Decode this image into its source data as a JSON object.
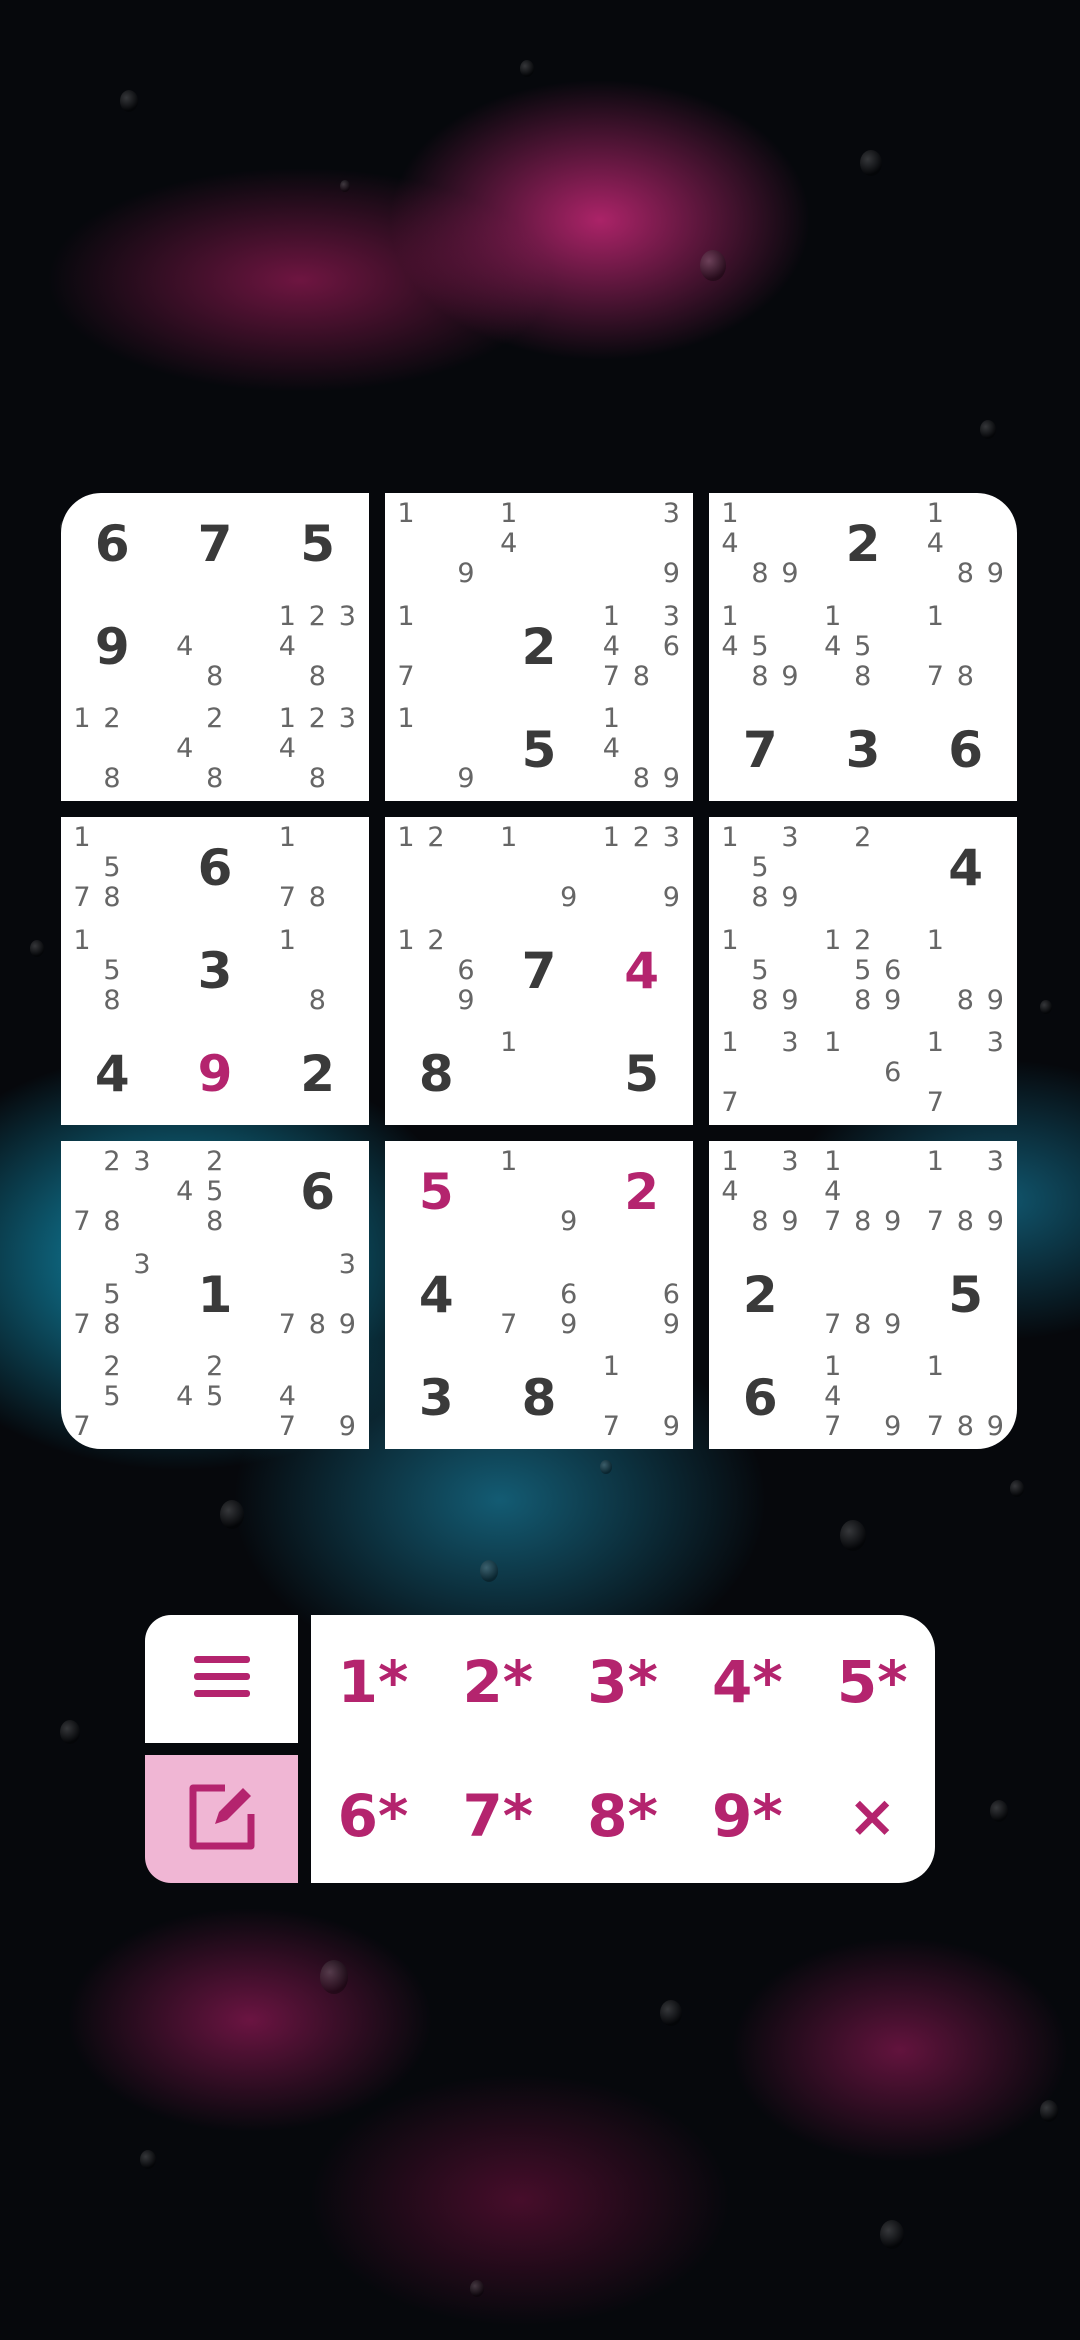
{
  "grid": [
    [
      {
        "v": "6"
      },
      {
        "v": "7"
      },
      {
        "v": "5"
      },
      {
        "n": [
          1,
          9
        ]
      },
      {
        "n": [
          1,
          4
        ]
      },
      {
        "n": [
          3,
          9
        ]
      },
      {
        "n": [
          1,
          4,
          8,
          9
        ]
      },
      {
        "v": "2"
      },
      {
        "n": [
          1,
          4,
          8,
          9
        ]
      }
    ],
    [
      {
        "v": "9"
      },
      {
        "n": [
          4,
          8
        ]
      },
      {
        "n": [
          1,
          2,
          3,
          4,
          8
        ]
      },
      {
        "n": [
          1,
          7
        ]
      },
      {
        "v": "2"
      },
      {
        "n": [
          1,
          3,
          4,
          6,
          7,
          8
        ]
      },
      {
        "n": [
          1,
          4,
          5,
          8,
          9
        ]
      },
      {
        "n": [
          1,
          4,
          5,
          8
        ]
      },
      {
        "n": [
          1,
          7,
          8
        ]
      }
    ],
    [
      {
        "n": [
          1,
          2,
          8
        ]
      },
      {
        "n": [
          2,
          4,
          8
        ]
      },
      {
        "n": [
          1,
          2,
          3,
          4,
          8
        ]
      },
      {
        "n": [
          1,
          9
        ]
      },
      {
        "v": "5"
      },
      {
        "n": [
          1,
          4,
          8,
          9
        ]
      },
      {
        "v": "7"
      },
      {
        "v": "3"
      },
      {
        "v": "6"
      }
    ],
    [
      {
        "n": [
          1,
          5,
          7,
          8
        ]
      },
      {
        "v": "6"
      },
      {
        "n": [
          1,
          7,
          8
        ]
      },
      {
        "n": [
          1,
          2
        ]
      },
      {
        "n": [
          1,
          9
        ]
      },
      {
        "n": [
          1,
          2,
          3,
          9
        ]
      },
      {
        "n": [
          1,
          3,
          5,
          8,
          9
        ]
      },
      {
        "n": [
          2
        ]
      },
      {
        "v": "4"
      }
    ],
    [
      {
        "n": [
          1,
          5,
          8
        ]
      },
      {
        "v": "3"
      },
      {
        "n": [
          1,
          8
        ]
      },
      {
        "n": [
          1,
          2,
          6,
          9
        ]
      },
      {
        "v": "7"
      },
      {
        "v": "4",
        "u": true
      },
      {
        "n": [
          1,
          5,
          8,
          9
        ]
      },
      {
        "n": [
          1,
          2,
          5,
          6,
          8,
          9
        ]
      },
      {
        "n": [
          1,
          8,
          9
        ]
      }
    ],
    [
      {
        "v": "4"
      },
      {
        "v": "9",
        "u": true
      },
      {
        "v": "2"
      },
      {
        "v": "8"
      },
      {
        "n": [
          1
        ]
      },
      {
        "v": "5"
      },
      {
        "n": [
          1,
          3,
          7
        ]
      },
      {
        "n": [
          1,
          6
        ]
      },
      {
        "n": [
          1,
          3,
          7
        ]
      }
    ],
    [
      {
        "n": [
          2,
          3,
          7,
          8
        ]
      },
      {
        "n": [
          2,
          4,
          5,
          8
        ]
      },
      {
        "v": "6"
      },
      {
        "v": "5",
        "u": true
      },
      {
        "n": [
          1,
          9
        ]
      },
      {
        "v": "2",
        "u": true
      },
      {
        "n": [
          1,
          3,
          4,
          8,
          9
        ]
      },
      {
        "n": [
          1,
          4,
          7,
          8,
          9
        ]
      },
      {
        "n": [
          1,
          3,
          7,
          8,
          9
        ]
      }
    ],
    [
      {
        "n": [
          3,
          5,
          7,
          8
        ]
      },
      {
        "v": "1"
      },
      {
        "n": [
          3,
          7,
          8,
          9
        ]
      },
      {
        "v": "4"
      },
      {
        "n": [
          6,
          7,
          9
        ]
      },
      {
        "n": [
          6,
          9
        ]
      },
      {
        "v": "2"
      },
      {
        "n": [
          7,
          8,
          9
        ]
      },
      {
        "v": "5"
      }
    ],
    [
      {
        "n": [
          2,
          5,
          7
        ]
      },
      {
        "n": [
          2,
          4,
          5
        ]
      },
      {
        "n": [
          4,
          7,
          9
        ]
      },
      {
        "v": "3"
      },
      {
        "v": "8"
      },
      {
        "n": [
          1,
          7,
          9
        ]
      },
      {
        "v": "6"
      },
      {
        "n": [
          1,
          4,
          7,
          9
        ]
      },
      {
        "n": [
          1,
          7,
          8,
          9
        ]
      }
    ]
  ],
  "controls": {
    "menu_icon": "menu-icon",
    "edit_icon": "edit-note-icon",
    "keys": [
      "1*",
      "2*",
      "3*",
      "4*",
      "5*",
      "6*",
      "7*",
      "8*",
      "9*",
      "×"
    ]
  },
  "colors": {
    "accent": "#b4246e",
    "given_digit": "#3a3a3a",
    "note_digit": "#666666",
    "edit_active": "#f0b6d4"
  }
}
